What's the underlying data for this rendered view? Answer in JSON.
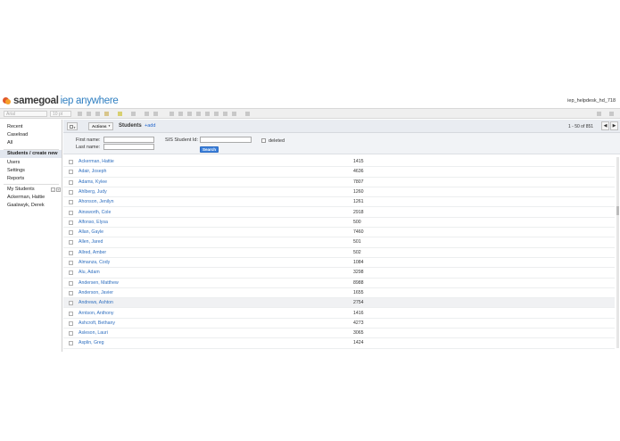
{
  "header": {
    "brand_primary": "samegoal",
    "brand_secondary": "iep anywhere",
    "user": "iep_helpdesk_hd_718"
  },
  "toolbar": {
    "font_name": "Arial",
    "font_size": "10 pt"
  },
  "sidebar": {
    "items": [
      {
        "label": "Recent"
      },
      {
        "label": "Caseload"
      },
      {
        "label": "All"
      },
      {
        "label": "Students / create new"
      },
      {
        "label": "Users"
      },
      {
        "label": "Settings"
      },
      {
        "label": "Reports"
      }
    ],
    "my_students_label": "My Students",
    "my_students": [
      "Ackerman, Hattie",
      "Gaalswyk, Derek"
    ]
  },
  "actionbar": {
    "actions_label": "Actions",
    "title": "Students",
    "add_label": "+add",
    "pager_text": "1 - 50 of 851",
    "prev_symbol": "◀",
    "next_symbol": "▶"
  },
  "search": {
    "first_name_label": "First name:",
    "last_name_label": "Last name:",
    "sis_label": "SIS Student Id:",
    "deleted_label": "deleted",
    "first_name_value": "",
    "last_name_value": "",
    "sis_value": "",
    "button_label": "Search"
  },
  "students": [
    {
      "name": "Ackerman, Hattie",
      "id": "1415"
    },
    {
      "name": "Adair, Joseph",
      "id": "4636"
    },
    {
      "name": "Adams, Kylee",
      "id": "7807"
    },
    {
      "name": "Ahlberg, Judy",
      "id": "1260"
    },
    {
      "name": "Ahonson, Jenilyn",
      "id": "1261"
    },
    {
      "name": "Ainsworth, Cole",
      "id": "2918"
    },
    {
      "name": "Alfonso, Elysa",
      "id": "500"
    },
    {
      "name": "Allan, Gayle",
      "id": "7460"
    },
    {
      "name": "Allen, Jared",
      "id": "501"
    },
    {
      "name": "Allred, Amber",
      "id": "502"
    },
    {
      "name": "Almanza, Cody",
      "id": "1084"
    },
    {
      "name": "Alu, Adam",
      "id": "3298"
    },
    {
      "name": "Andersen, Matthew",
      "id": "8988"
    },
    {
      "name": "Anderson, Javier",
      "id": "1655"
    },
    {
      "name": "Andrews, Ashton",
      "id": "2754"
    },
    {
      "name": "Arntson, Anthony",
      "id": "1416"
    },
    {
      "name": "Ashcroft, Bethany",
      "id": "4273"
    },
    {
      "name": "Asleson, Lauri",
      "id": "3065"
    },
    {
      "name": "Asplin, Greg",
      "id": "1424"
    }
  ],
  "highlighted_row": "Andrews, Ashton",
  "colors": {
    "brand_orange": "#e0582a",
    "brand_blue": "#2f7fc1",
    "link_blue": "#2f6fbf",
    "search_button": "#3b7fd9"
  }
}
